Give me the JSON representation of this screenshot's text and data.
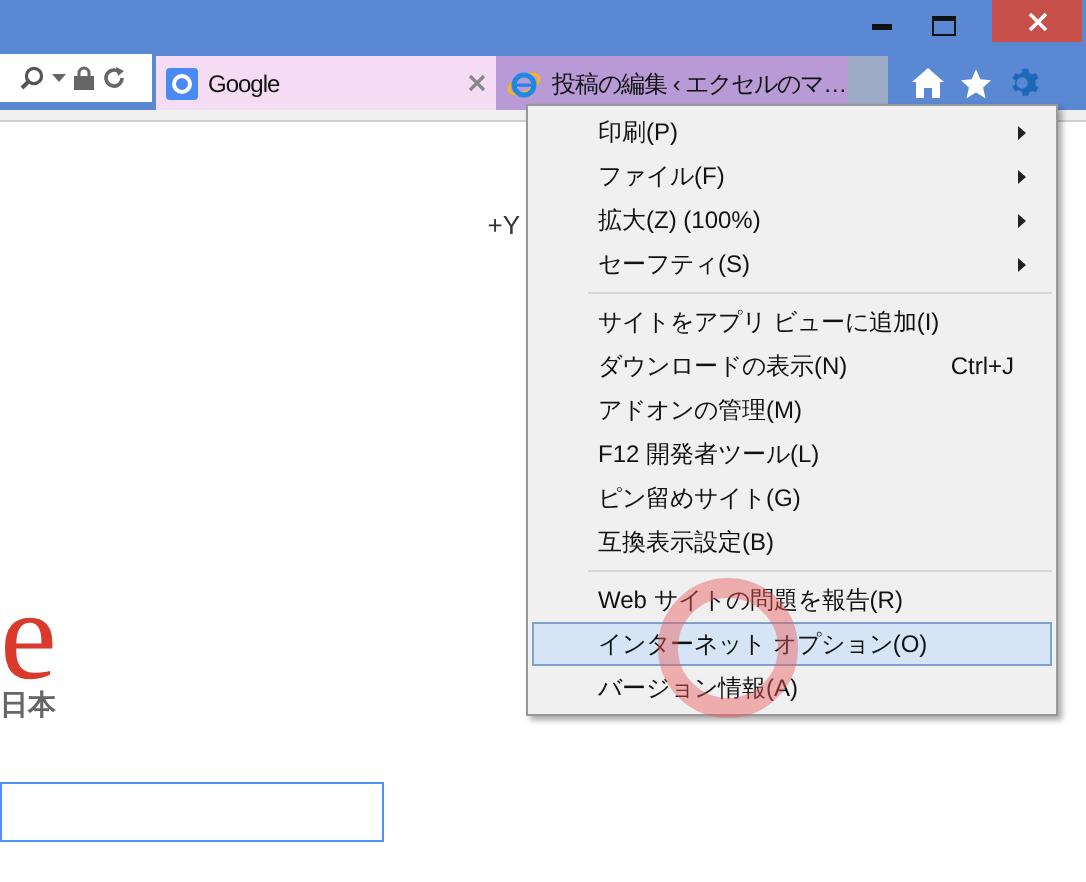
{
  "tabs": [
    {
      "title": "Google",
      "selected": true,
      "kind": "google"
    },
    {
      "title": "投稿の編集 ‹ エクセルのマ…",
      "selected": false,
      "kind": "ie"
    }
  ],
  "page": {
    "top_link": "+Y",
    "logo_text": "e",
    "logo_region": "日本"
  },
  "menu": {
    "sections": [
      [
        {
          "label": "印刷(P)",
          "submenu": true,
          "selected": false
        },
        {
          "label": "ファイル(F)",
          "submenu": true,
          "selected": false
        },
        {
          "label": "拡大(Z) (100%)",
          "submenu": true,
          "selected": false
        },
        {
          "label": "セーフティ(S)",
          "submenu": true,
          "selected": false
        }
      ],
      [
        {
          "label": "サイトをアプリ ビューに追加(I)",
          "submenu": false,
          "selected": false
        },
        {
          "label": "ダウンロードの表示(N)",
          "shortcut": "Ctrl+J",
          "submenu": false,
          "selected": false
        },
        {
          "label": "アドオンの管理(M)",
          "submenu": false,
          "selected": false
        },
        {
          "label": "F12 開発者ツール(L)",
          "submenu": false,
          "selected": false
        },
        {
          "label": "ピン留めサイト(G)",
          "submenu": false,
          "selected": false
        },
        {
          "label": "互換表示設定(B)",
          "submenu": false,
          "selected": false
        }
      ],
      [
        {
          "label": "Web サイトの問題を報告(R)",
          "submenu": false,
          "selected": false
        },
        {
          "label": "インターネット オプション(O)",
          "submenu": false,
          "selected": true
        },
        {
          "label": "バージョン情報(A)",
          "submenu": false,
          "selected": false
        }
      ]
    ]
  }
}
